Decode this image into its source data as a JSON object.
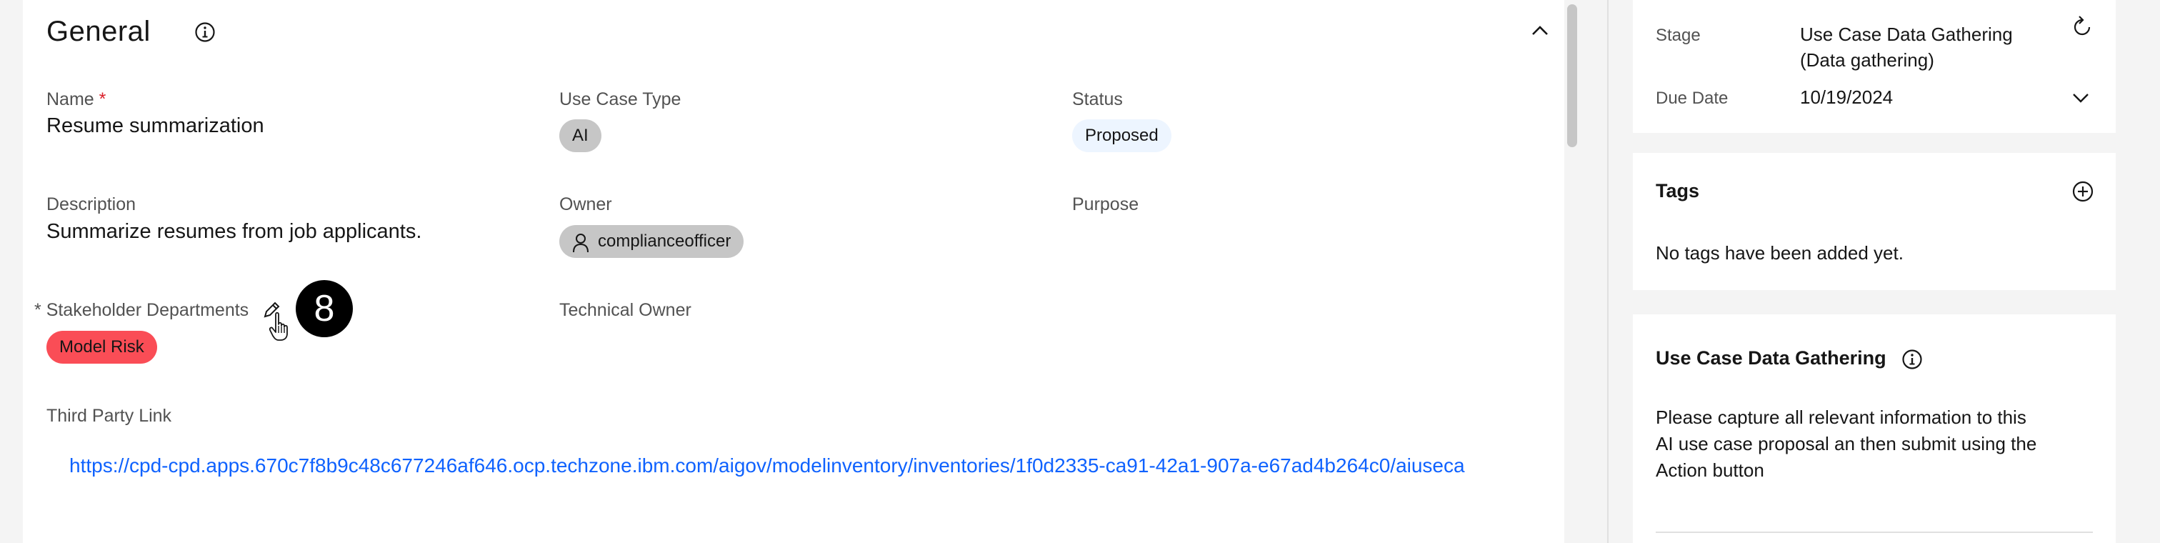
{
  "general": {
    "title": "General",
    "info_icon": "info-icon",
    "collapse_icon": "chevron-up-icon",
    "name": {
      "label": "Name",
      "required_mark": "*",
      "value": "Resume summarization"
    },
    "use_case_type": {
      "label": "Use Case Type",
      "value": "AI"
    },
    "status": {
      "label": "Status",
      "value": "Proposed"
    },
    "description": {
      "label": "Description",
      "value": "Summarize resumes from job applicants."
    },
    "owner": {
      "label": "Owner",
      "value": "complianceofficer",
      "icon": "user-icon"
    },
    "purpose": {
      "label": "Purpose"
    },
    "stakeholder_departments": {
      "label": "Stakeholder Departments",
      "required_mark": "*",
      "value": "Model Risk",
      "edit_icon": "pencil-icon"
    },
    "technical_owner": {
      "label": "Technical Owner"
    },
    "third_party_link": {
      "label": "Third Party Link",
      "value": "https://cpd-cpd.apps.670c7f8b9c48c677246af646.ocp.techzone.ibm.com/aigov/modelinventory/inventories/1f0d2335-ca91-42a1-907a-e67ad4b264c0/aiuseca"
    }
  },
  "step_badge": "8",
  "side": {
    "stage": {
      "label": "Stage",
      "value_line1": "Use Case Data Gathering",
      "value_line2": "(Data gathering)",
      "icon": "refresh-icon"
    },
    "due_date": {
      "label": "Due Date",
      "value": "10/19/2024",
      "icon": "chevron-down-icon"
    },
    "tags": {
      "title": "Tags",
      "empty_text": "No tags have been added yet.",
      "icon": "add-circle-icon"
    },
    "data_gathering": {
      "title": "Use Case Data Gathering",
      "icon": "info-icon",
      "line1": "Please capture all relevant information to this",
      "line2": "AI use case proposal an then submit using the",
      "line3": "Action button"
    }
  }
}
